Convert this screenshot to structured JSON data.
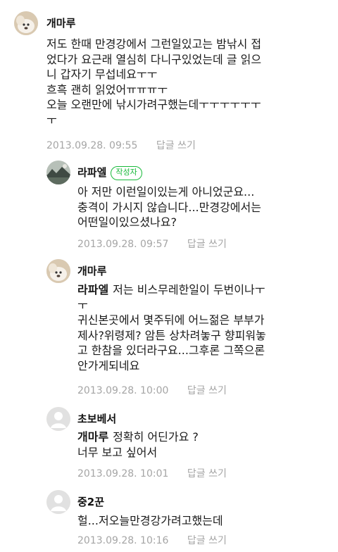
{
  "comments": [
    {
      "author": "개마루",
      "lines": [
        "저도 한때 만경강에서 그런일있고는 밤낚시 접",
        "었다가 요근래 열심히 다니구있었는데 글 읽으",
        "니 갑자기 무섭네요ㅜㅜ",
        "흐흑 괜히 읽었어ㅠㅠㅠㅜ",
        "오늘 오랜만에 낚시가려구했는데ㅜㅜㅜㅜㅜㅜ",
        "ㅜ"
      ],
      "date": "2013.09.28. 09:55",
      "reply_label": "답글 쓰기"
    },
    {
      "author": "라파엘",
      "badge": "작성자",
      "lines": [
        "아 저만 이런일이있는게 아니었군요...",
        "충격이 가시지 않습니다...만경강에서는",
        "어떤일이있으셨나요?"
      ],
      "date": "2013.09.28. 09:57",
      "reply_label": "답글 쓰기"
    },
    {
      "author": "개마루",
      "mention": "라파엘",
      "lines": [
        "저는 비스무레한일이 두번이나ㅜ",
        "ㅜ",
        "귀신본곳에서 몇주뒤에 어느젊은 부부가",
        "제사?위령제? 암튼 상차려놓구 향피워놓",
        "고 한참을 있더라구요...그후론 그쪽으론",
        "안가게되네요"
      ],
      "date": "2013.09.28. 10:00",
      "reply_label": "답글 쓰기"
    },
    {
      "author": "초보베서",
      "mention": "개마루",
      "lines": [
        "정확히 어딘가요 ?",
        "너무 보고 싶어서"
      ],
      "date": "2013.09.28. 10:01",
      "reply_label": "답글 쓰기"
    },
    {
      "author": "중2꾼",
      "lines": [
        "헐...저오늘만경강가려고했는데"
      ],
      "date": "2013.09.28. 10:16",
      "reply_label": "답글 쓰기"
    }
  ],
  "colors": {
    "badge_green": "#18b93a",
    "meta_gray": "#a5a5a5"
  }
}
